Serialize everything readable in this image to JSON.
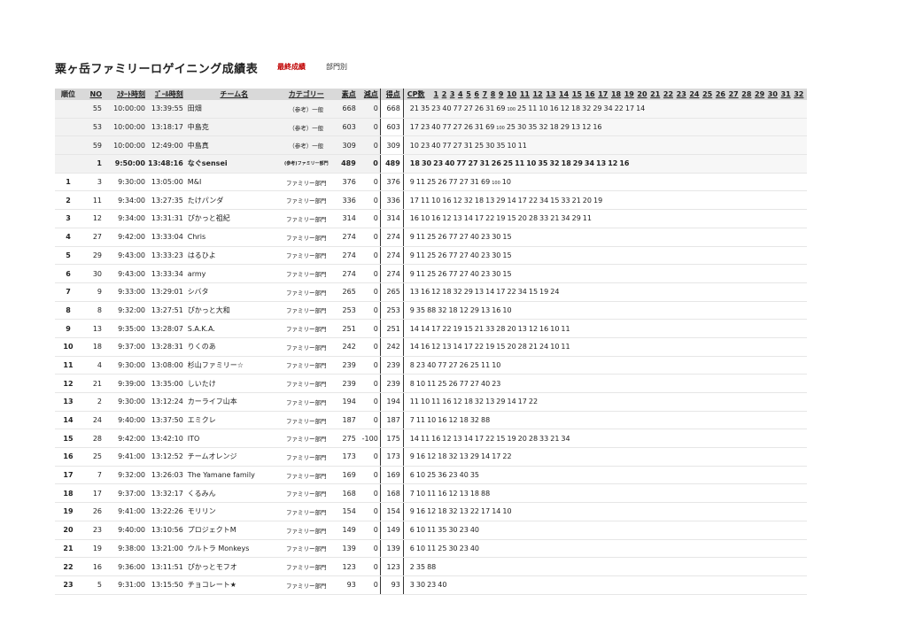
{
  "header": {
    "title": "粟ヶ岳ファミリーロゲイニング成績表",
    "status": "最終成績",
    "dept": "部門別"
  },
  "columns": {
    "rank": "順位",
    "no": "NO",
    "start": "ｽﾀｰﾄ時刻",
    "goal": "ｺﾞｰﾙ時刻",
    "team": "チーム名",
    "category": "カテゴリー",
    "raw": "素点",
    "penalty": "減点",
    "score": "得点",
    "cp": "CP数",
    "cp_numbers": [
      "1",
      "2",
      "3",
      "4",
      "5",
      "6",
      "7",
      "8",
      "9",
      "10",
      "11",
      "12",
      "13",
      "14",
      "15",
      "16",
      "17",
      "18",
      "19",
      "20",
      "21",
      "22",
      "23",
      "24",
      "25",
      "26",
      "27",
      "28",
      "29",
      "30",
      "31",
      "32"
    ]
  },
  "rows": [
    {
      "rank": "",
      "no": "55",
      "start": "10:00:00",
      "goal": "13:39:55",
      "team": "田畑",
      "category": "（参考）一般",
      "raw": "668",
      "penalty": "0",
      "score": "668",
      "cps": [
        "21",
        "35",
        "23",
        "40",
        "77",
        "27",
        "26",
        "31",
        "69",
        "100",
        "25",
        "11",
        "10",
        "16",
        "12",
        "18",
        "32",
        "29",
        "34",
        "22",
        "17",
        "14"
      ],
      "ref": true
    },
    {
      "rank": "",
      "no": "53",
      "start": "10:00:00",
      "goal": "13:18:17",
      "team": "中島克",
      "category": "（参考）一般",
      "raw": "603",
      "penalty": "0",
      "score": "603",
      "cps": [
        "17",
        "23",
        "40",
        "77",
        "27",
        "26",
        "31",
        "69",
        "100",
        "25",
        "30",
        "35",
        "32",
        "18",
        "29",
        "13",
        "12",
        "16"
      ],
      "ref": true
    },
    {
      "rank": "",
      "no": "59",
      "start": "10:00:00",
      "goal": "12:49:00",
      "team": "中島真",
      "category": "（参考）一般",
      "raw": "309",
      "penalty": "0",
      "score": "309",
      "cps": [
        "10",
        "23",
        "40",
        "77",
        "27",
        "31",
        "25",
        "30",
        "35",
        "10",
        "11"
      ],
      "ref": true
    },
    {
      "rank": "",
      "no": "1",
      "start": "9:50:00",
      "goal": "13:48:16",
      "team": "なぐsensei",
      "category": "(参考)ファミリー部門",
      "raw": "489",
      "penalty": "0",
      "score": "489",
      "cps": [
        "18",
        "30",
        "23",
        "40",
        "77",
        "27",
        "31",
        "26",
        "25",
        "11",
        "10",
        "35",
        "32",
        "18",
        "29",
        "34",
        "13",
        "12",
        "16"
      ],
      "ref": true,
      "bold": true
    },
    {
      "rank": "1",
      "no": "3",
      "start": "9:30:00",
      "goal": "13:05:00",
      "team": "M&I",
      "category": "ファミリー部門",
      "raw": "376",
      "penalty": "0",
      "score": "376",
      "cps": [
        "9",
        "11",
        "25",
        "26",
        "77",
        "27",
        "31",
        "69",
        "100",
        "10"
      ]
    },
    {
      "rank": "2",
      "no": "11",
      "start": "9:34:00",
      "goal": "13:27:35",
      "team": "たけパンダ",
      "category": "ファミリー部門",
      "raw": "336",
      "penalty": "0",
      "score": "336",
      "cps": [
        "17",
        "11",
        "10",
        "16",
        "12",
        "32",
        "18",
        "13",
        "29",
        "14",
        "17",
        "22",
        "34",
        "15",
        "33",
        "21",
        "20",
        "19"
      ]
    },
    {
      "rank": "3",
      "no": "12",
      "start": "9:34:00",
      "goal": "13:31:31",
      "team": "ぴかっと祖紀",
      "category": "ファミリー部門",
      "raw": "314",
      "penalty": "0",
      "score": "314",
      "cps": [
        "16",
        "10",
        "16",
        "12",
        "13",
        "14",
        "17",
        "22",
        "19",
        "15",
        "20",
        "28",
        "33",
        "21",
        "34",
        "29",
        "11"
      ]
    },
    {
      "rank": "4",
      "no": "27",
      "start": "9:42:00",
      "goal": "13:33:04",
      "team": "Chris",
      "category": "ファミリー部門",
      "raw": "274",
      "penalty": "0",
      "score": "274",
      "cps": [
        "9",
        "11",
        "25",
        "26",
        "77",
        "27",
        "40",
        "23",
        "30",
        "15"
      ]
    },
    {
      "rank": "5",
      "no": "29",
      "start": "9:43:00",
      "goal": "13:33:23",
      "team": "はるひよ",
      "category": "ファミリー部門",
      "raw": "274",
      "penalty": "0",
      "score": "274",
      "cps": [
        "9",
        "11",
        "25",
        "26",
        "77",
        "27",
        "40",
        "23",
        "30",
        "15"
      ]
    },
    {
      "rank": "6",
      "no": "30",
      "start": "9:43:00",
      "goal": "13:33:34",
      "team": "army",
      "category": "ファミリー部門",
      "raw": "274",
      "penalty": "0",
      "score": "274",
      "cps": [
        "9",
        "11",
        "25",
        "26",
        "77",
        "27",
        "40",
        "23",
        "30",
        "15"
      ]
    },
    {
      "rank": "7",
      "no": "9",
      "start": "9:33:00",
      "goal": "13:29:01",
      "team": "シバタ",
      "category": "ファミリー部門",
      "raw": "265",
      "penalty": "0",
      "score": "265",
      "cps": [
        "13",
        "16",
        "12",
        "18",
        "32",
        "29",
        "13",
        "14",
        "17",
        "22",
        "34",
        "15",
        "19",
        "24"
      ]
    },
    {
      "rank": "8",
      "no": "8",
      "start": "9:32:00",
      "goal": "13:27:51",
      "team": "ぴかっと大和",
      "category": "ファミリー部門",
      "raw": "253",
      "penalty": "0",
      "score": "253",
      "cps": [
        "9",
        "35",
        "88",
        "32",
        "18",
        "12",
        "29",
        "13",
        "16",
        "10"
      ]
    },
    {
      "rank": "9",
      "no": "13",
      "start": "9:35:00",
      "goal": "13:28:07",
      "team": "S.A.K.A.",
      "category": "ファミリー部門",
      "raw": "251",
      "penalty": "0",
      "score": "251",
      "cps": [
        "14",
        "14",
        "17",
        "22",
        "19",
        "15",
        "21",
        "33",
        "28",
        "20",
        "13",
        "12",
        "16",
        "10",
        "11"
      ]
    },
    {
      "rank": "10",
      "no": "18",
      "start": "9:37:00",
      "goal": "13:28:31",
      "team": "りくのあ",
      "category": "ファミリー部門",
      "raw": "242",
      "penalty": "0",
      "score": "242",
      "cps": [
        "14",
        "16",
        "12",
        "13",
        "14",
        "17",
        "22",
        "19",
        "15",
        "20",
        "28",
        "21",
        "24",
        "10",
        "11"
      ]
    },
    {
      "rank": "11",
      "no": "4",
      "start": "9:30:00",
      "goal": "13:08:00",
      "team": "杉山ファミリー☆",
      "category": "ファミリー部門",
      "raw": "239",
      "penalty": "0",
      "score": "239",
      "cps": [
        "8",
        "23",
        "40",
        "77",
        "27",
        "26",
        "25",
        "11",
        "10"
      ]
    },
    {
      "rank": "12",
      "no": "21",
      "start": "9:39:00",
      "goal": "13:35:00",
      "team": "しいたけ",
      "category": "ファミリー部門",
      "raw": "239",
      "penalty": "0",
      "score": "239",
      "cps": [
        "8",
        "10",
        "11",
        "25",
        "26",
        "77",
        "27",
        "40",
        "23"
      ]
    },
    {
      "rank": "13",
      "no": "2",
      "start": "9:30:00",
      "goal": "13:12:24",
      "team": "カーライフ山本",
      "category": "ファミリー部門",
      "raw": "194",
      "penalty": "0",
      "score": "194",
      "cps": [
        "11",
        "10",
        "11",
        "16",
        "12",
        "18",
        "32",
        "13",
        "29",
        "14",
        "17",
        "22"
      ]
    },
    {
      "rank": "14",
      "no": "24",
      "start": "9:40:00",
      "goal": "13:37:50",
      "team": "エミクレ",
      "category": "ファミリー部門",
      "raw": "187",
      "penalty": "0",
      "score": "187",
      "cps": [
        "7",
        "11",
        "10",
        "16",
        "12",
        "18",
        "32",
        "88"
      ]
    },
    {
      "rank": "15",
      "no": "28",
      "start": "9:42:00",
      "goal": "13:42:10",
      "team": "ITO",
      "category": "ファミリー部門",
      "raw": "275",
      "penalty": "-100",
      "score": "175",
      "cps": [
        "14",
        "11",
        "16",
        "12",
        "13",
        "14",
        "17",
        "22",
        "15",
        "19",
        "20",
        "28",
        "33",
        "21",
        "34"
      ]
    },
    {
      "rank": "16",
      "no": "25",
      "start": "9:41:00",
      "goal": "13:12:52",
      "team": "チームオレンジ",
      "category": "ファミリー部門",
      "raw": "173",
      "penalty": "0",
      "score": "173",
      "cps": [
        "9",
        "16",
        "12",
        "18",
        "32",
        "13",
        "29",
        "14",
        "17",
        "22"
      ]
    },
    {
      "rank": "17",
      "no": "7",
      "start": "9:32:00",
      "goal": "13:26:03",
      "team": "The Yamane family",
      "category": "ファミリー部門",
      "raw": "169",
      "penalty": "0",
      "score": "169",
      "cps": [
        "6",
        "10",
        "25",
        "36",
        "23",
        "40",
        "35"
      ]
    },
    {
      "rank": "18",
      "no": "17",
      "start": "9:37:00",
      "goal": "13:32:17",
      "team": "くるみん",
      "category": "ファミリー部門",
      "raw": "168",
      "penalty": "0",
      "score": "168",
      "cps": [
        "7",
        "10",
        "11",
        "16",
        "12",
        "13",
        "18",
        "88"
      ]
    },
    {
      "rank": "19",
      "no": "26",
      "start": "9:41:00",
      "goal": "13:22:26",
      "team": "モリリン",
      "category": "ファミリー部門",
      "raw": "154",
      "penalty": "0",
      "score": "154",
      "cps": [
        "9",
        "16",
        "12",
        "18",
        "32",
        "13",
        "22",
        "17",
        "14",
        "10"
      ]
    },
    {
      "rank": "20",
      "no": "23",
      "start": "9:40:00",
      "goal": "13:10:56",
      "team": "プロジェクトM",
      "category": "ファミリー部門",
      "raw": "149",
      "penalty": "0",
      "score": "149",
      "cps": [
        "6",
        "10",
        "11",
        "35",
        "30",
        "23",
        "40"
      ]
    },
    {
      "rank": "21",
      "no": "19",
      "start": "9:38:00",
      "goal": "13:21:00",
      "team": "ウルトラ Monkeys",
      "category": "ファミリー部門",
      "raw": "139",
      "penalty": "0",
      "score": "139",
      "cps": [
        "6",
        "10",
        "11",
        "25",
        "30",
        "23",
        "40"
      ]
    },
    {
      "rank": "22",
      "no": "16",
      "start": "9:36:00",
      "goal": "13:11:51",
      "team": "ぴかっとモフオ",
      "category": "ファミリー部門",
      "raw": "123",
      "penalty": "0",
      "score": "123",
      "cps": [
        "2",
        "35",
        "88"
      ]
    },
    {
      "rank": "23",
      "no": "5",
      "start": "9:31:00",
      "goal": "13:15:50",
      "team": "チョコレート★",
      "category": "ファミリー部門",
      "raw": "93",
      "penalty": "0",
      "score": "93",
      "cps": [
        "3",
        "30",
        "23",
        "40"
      ]
    }
  ]
}
